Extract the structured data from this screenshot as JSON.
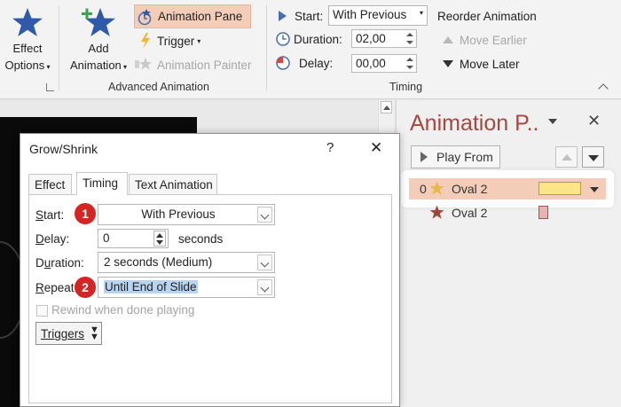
{
  "ribbon": {
    "effect_options": {
      "line1": "Effect",
      "line2": "Options"
    },
    "add_animation": {
      "line1": "Add",
      "line2": "Animation"
    },
    "animation_pane": "Animation Pane",
    "trigger": "Trigger",
    "animation_painter": "Animation Painter",
    "advanced_group_label": "Advanced Animation",
    "start_label": "Start:",
    "start_value": "With Previous",
    "duration_label": "Duration:",
    "duration_value": "02,00",
    "delay_label": "Delay:",
    "delay_value": "00,00",
    "timing_group_label": "Timing",
    "reorder_title": "Reorder Animation",
    "move_earlier": "Move Earlier",
    "move_later": "Move Later"
  },
  "animation_pane": {
    "title": "Animation P..",
    "play_from": "Play From",
    "items": [
      {
        "index": "0",
        "name": "Oval 2",
        "bar_color": "#fce588"
      },
      {
        "index": "",
        "name": "Oval 2",
        "bar_color": "#e8b4b0"
      }
    ]
  },
  "dialog": {
    "title": "Grow/Shrink",
    "help": "?",
    "close": "✕",
    "tabs": [
      "Effect",
      "Timing",
      "Text Animation"
    ],
    "start_label": "Start:",
    "start_value": "With Previous",
    "delay_label": "Delay:",
    "delay_value": "0",
    "delay_unit": "seconds",
    "duration_label": "Duration:",
    "duration_value": "2 seconds (Medium)",
    "repeat_label": "Repeat:",
    "repeat_value": "Until End of Slide",
    "rewind_label": "Rewind when done playing",
    "triggers_label": "Triggers"
  },
  "badges": [
    "1",
    "2"
  ],
  "colors": {
    "accent": "#a84640",
    "highlight": "#f4cdb9",
    "badge": "#d42423",
    "star_blue": "#2e5aa8",
    "star_gold": "#e8b94a",
    "star_brown": "#a0473b"
  }
}
